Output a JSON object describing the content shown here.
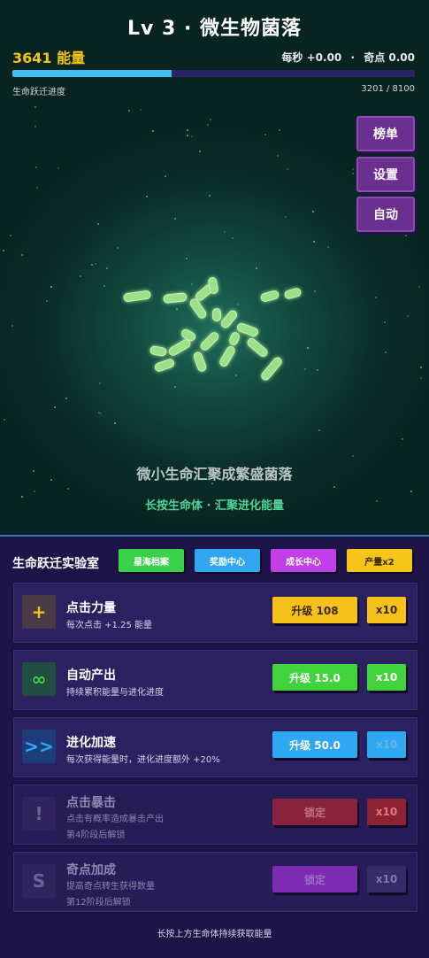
{
  "header": {
    "title": "Lv 3 · 微生物菌落",
    "energy": "3641 能量",
    "per_second": "每秒 +0.00",
    "separator": "·",
    "singularity": "奇点 0.00"
  },
  "progress": {
    "label": "生命跃迁进度",
    "count": "3201 / 8100",
    "fraction": 0.395
  },
  "side_buttons": {
    "leaderboard": "榜单",
    "settings": "设置",
    "auto": "自动"
  },
  "scene": {
    "hint_main": "微小生命汇聚成繁盛菌落",
    "hint_sub": "长按生命体 · 汇聚进化能量"
  },
  "lab": {
    "title": "生命跃迁实验室",
    "tabs": [
      {
        "label": "星海档案",
        "color": "#39d24a"
      },
      {
        "label": "奖励中心",
        "color": "#2fa6ef"
      },
      {
        "label": "成长中心",
        "color": "#c23ee8"
      },
      {
        "label": "产量x2",
        "color": "#f5c518"
      }
    ],
    "upgrades": [
      {
        "icon": "+",
        "icon_name": "plus-icon",
        "name": "点击力量",
        "desc": "每次点击 +1.25 能量",
        "lock_text": "",
        "button": "升级 108",
        "x10": "x10",
        "color": "#f6c11a",
        "locked": false
      },
      {
        "icon": "∞",
        "icon_name": "infinity-icon",
        "name": "自动产出",
        "desc": "持续累积能量与进化进度",
        "lock_text": "",
        "button": "升级 15.0",
        "x10": "x10",
        "color": "#40d33b",
        "locked": false
      },
      {
        "icon": ">>",
        "icon_name": "double-chevron-icon",
        "name": "进化加速",
        "desc": "每次获得能量时，进化进度额外 +20%",
        "lock_text": "",
        "button": "升级 50.0",
        "x10": "x10",
        "color": "#2ea8f2",
        "locked": false
      },
      {
        "icon": "!",
        "icon_name": "exclamation-icon",
        "name": "点击暴击",
        "desc": "点击有概率造成暴击产出",
        "lock_text": "第4阶段后解锁",
        "button": "锁定",
        "x10": "x10",
        "color": "#9b2438",
        "locked": true
      },
      {
        "icon": "S",
        "icon_name": "s-letter-icon",
        "name": "奇点加成",
        "desc": "提高奇点转生获得数量",
        "lock_text": "第12阶段后解锁",
        "button": "锁定",
        "x10": "x10",
        "color": "#8c2ec3",
        "locked": true
      }
    ],
    "footer": "长按上方生命体持续获取能量"
  }
}
